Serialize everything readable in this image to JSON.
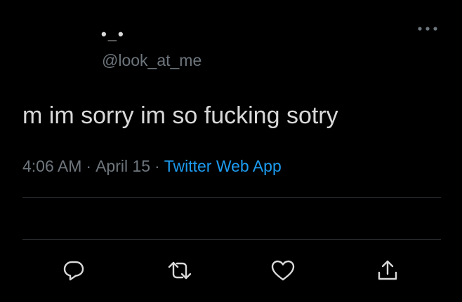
{
  "tweet": {
    "display_name": "•_•",
    "handle": "@look_at_me",
    "text": "m im sorry im so fucking sotry",
    "time": "4:06 AM",
    "separator": "·",
    "date": "April 15",
    "source": "Twitter Web App"
  },
  "icons": {
    "more": "more-options-icon",
    "reply": "reply-icon",
    "retweet": "retweet-icon",
    "like": "like-icon",
    "share": "share-icon"
  },
  "colors": {
    "background": "#000000",
    "text": "#d9d9d9",
    "secondary_text": "#6e767d",
    "link": "#1d9bf0",
    "divider": "#2f3336"
  }
}
